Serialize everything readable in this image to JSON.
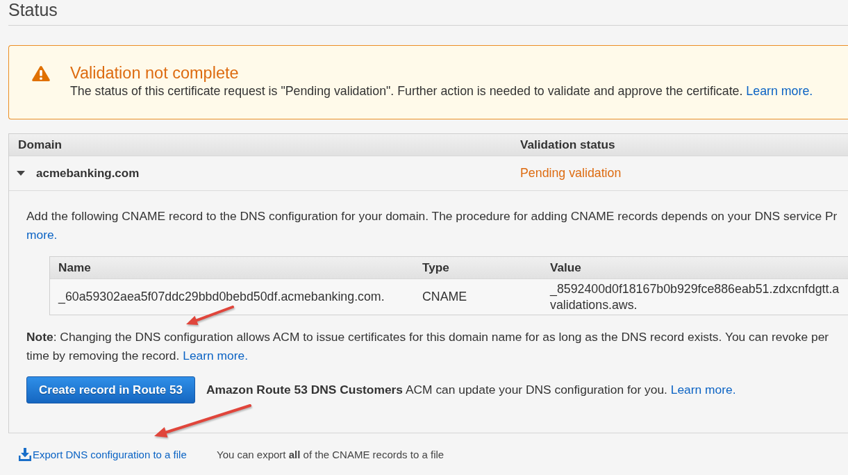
{
  "page": {
    "title": "Status"
  },
  "alert": {
    "kind": "warning",
    "title": "Validation not complete",
    "message": "The status of this certificate request is \"Pending validation\". Further action is needed to validate and approve the certificate.",
    "link": "Learn more."
  },
  "domains_table": {
    "columns": [
      "Domain",
      "Validation status"
    ],
    "rows": [
      {
        "domain": "acmebanking.com",
        "status": "Pending validation",
        "color": "#dd6b10",
        "expanded": true,
        "details": {
          "instructions": {
            "text": "Add the following CNAME record to the DNS configuration for your domain. The procedure for adding CNAME records depends on your DNS service Pr",
            "link": "more."
          },
          "records_table": {
            "columns": [
              "Name",
              "Type",
              "Value"
            ],
            "rows": [
              {
                "name": "_60a59302aea5f07ddc29bbd0bebd50df.acmebanking.com.",
                "type": "CNAME",
                "value_lines": [
                  "_8592400d0f18167b0b929fce886eab51.zdxcnfdgtt.a",
                  "validations.aws."
                ]
              }
            ]
          },
          "note": {
            "lines": [
              "**Note**: Changing the DNS configuration allows ACM to issue certificates for this domain name for as long as the DNS record exists. You can revoke per",
              "time by removing the record."
            ],
            "link": "Learn more."
          },
          "route53": {
            "button": "Create record in Route 53",
            "text": "**Amazon Route 53 DNS Customers** ACM can update your DNS configuration for you.",
            "link": "Learn more."
          }
        }
      }
    ]
  },
  "export": {
    "link": "Export DNS configuration to a file",
    "description": "You can export **all** of the CNAME records to a file"
  }
}
